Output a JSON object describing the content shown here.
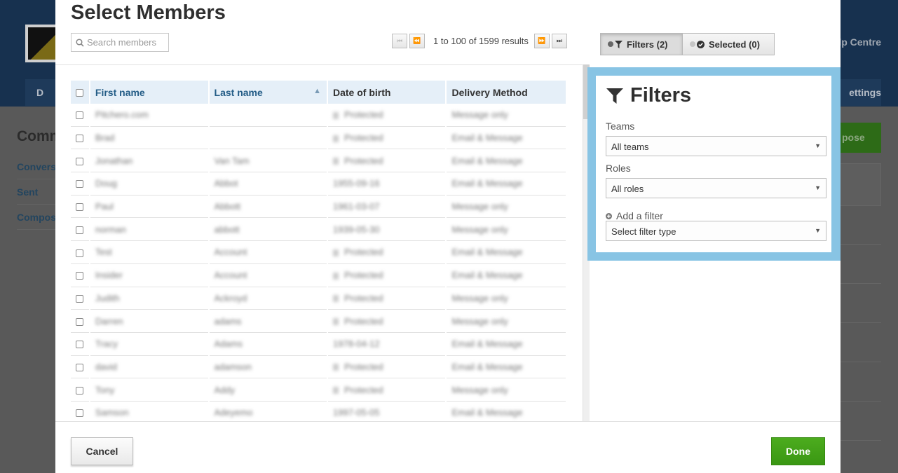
{
  "background": {
    "help_label": "lp Centre",
    "nav_left": "D",
    "nav_right": "ettings",
    "page_title": "Comm",
    "side_items": [
      "Convers",
      "Sent",
      "Compos"
    ],
    "compose_label": "pose"
  },
  "modal": {
    "title": "Select Members",
    "search": {
      "placeholder": "Search members"
    },
    "pagination": {
      "text": "1 to 100 of 1599 results"
    },
    "filters_tab": "Filters (2)",
    "selected_tab": "Selected (0)",
    "table": {
      "columns": [
        "First name",
        "Last name",
        "Date of birth",
        "Delivery Method"
      ],
      "sorted_column": "Last name",
      "rows": [
        [
          "Pitchero.com",
          "",
          "Protected",
          "Message only"
        ],
        [
          "Brad",
          "",
          "Protected",
          "Email & Message"
        ],
        [
          "Jonathan",
          "Van Tam",
          "Protected",
          "Email & Message"
        ],
        [
          "Doug",
          "Abbot",
          "1955-09-16",
          "Email & Message"
        ],
        [
          "Paul",
          "Abbott",
          "1961-03-07",
          "Message only"
        ],
        [
          "norman",
          "abbott",
          "1939-05-30",
          "Message only"
        ],
        [
          "Test",
          "Account",
          "Protected",
          "Email & Message"
        ],
        [
          "Insider",
          "Account",
          "Protected",
          "Email & Message"
        ],
        [
          "Judith",
          "Ackroyd",
          "Protected",
          "Message only"
        ],
        [
          "Darren",
          "adams",
          "Protected",
          "Message only"
        ],
        [
          "Tracy",
          "Adams",
          "1978-04-12",
          "Email & Message"
        ],
        [
          "david",
          "adamson",
          "Protected",
          "Email & Message"
        ],
        [
          "Tony",
          "Addy",
          "Protected",
          "Message only"
        ],
        [
          "Samson",
          "Adeyemo",
          "1997-05-05",
          "Email & Message"
        ]
      ]
    },
    "filters_panel": {
      "heading": "Filters",
      "teams_label": "Teams",
      "teams_value": "All teams",
      "roles_label": "Roles",
      "roles_value": "All roles",
      "add_filter": "Add a filter",
      "filter_type_value": "Select filter type"
    },
    "cancel_label": "Cancel",
    "done_label": "Done"
  }
}
